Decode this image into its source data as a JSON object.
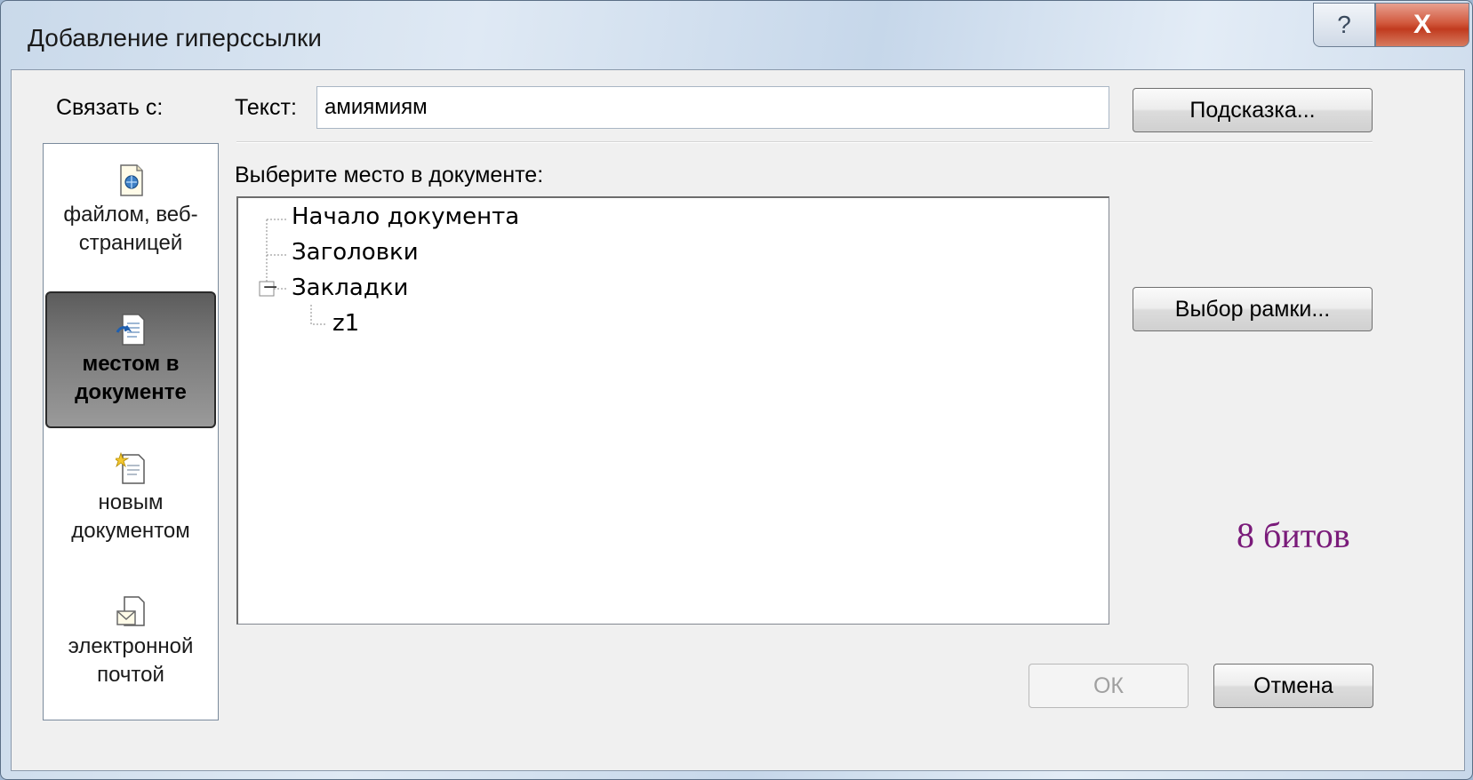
{
  "window": {
    "title": "Добавление гиперссылки",
    "help_glyph": "?",
    "close_glyph": "X"
  },
  "link_to": {
    "label": "Связать с:",
    "items": [
      {
        "label": "файлом, веб-страницей",
        "icon": "web-page-icon",
        "selected": false
      },
      {
        "label": "местом в документе",
        "icon": "place-in-document-icon",
        "selected": true
      },
      {
        "label": "новым документом",
        "icon": "new-document-icon",
        "selected": false
      },
      {
        "label": "электронной почтой",
        "icon": "email-icon",
        "selected": false
      }
    ]
  },
  "text_field": {
    "label": "Текст:",
    "value": "амиямиям"
  },
  "buttons": {
    "tooltip": "Подсказка...",
    "frame": "Выбор рамки...",
    "ok": "ОК",
    "cancel": "Отмена"
  },
  "place": {
    "label": "Выберите место в документе:",
    "tree": [
      {
        "label": "Начало документа",
        "level": 0
      },
      {
        "label": "Заголовки",
        "level": 0
      },
      {
        "label": "Закладки",
        "level": 0,
        "expanded": true
      },
      {
        "label": "z1",
        "level": 1
      }
    ]
  },
  "annotation": "8 битов",
  "colors": {
    "selected_link_bg": "#6e6e6e",
    "annotation_text": "#7a1b7a",
    "close_button": "#c13b1f"
  }
}
